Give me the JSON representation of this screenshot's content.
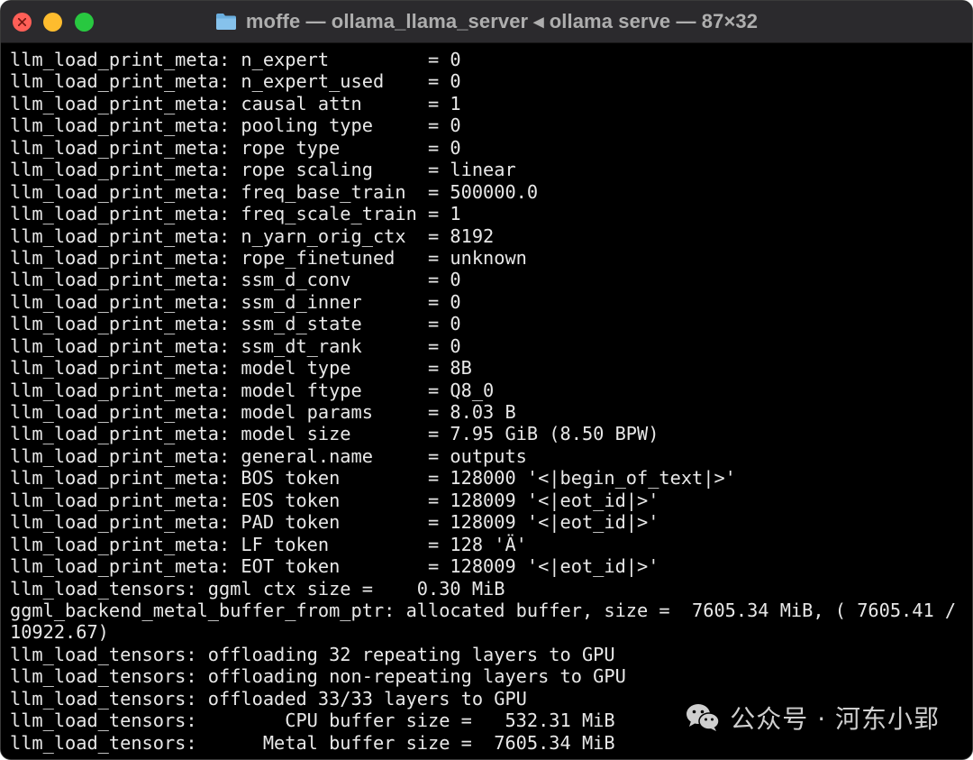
{
  "window": {
    "title": "moffe — ollama_llama_server ◂ ollama serve — 87×32",
    "folder_icon": "folder-icon",
    "colors": {
      "close": "#ff5f57",
      "minimize": "#febc2e",
      "zoom": "#28c840",
      "terminal_bg": "#000000",
      "terminal_fg": "#e8e8e8"
    }
  },
  "terminal": {
    "lines": [
      "llm_load_print_meta: n_expert         = 0",
      "llm_load_print_meta: n_expert_used    = 0",
      "llm_load_print_meta: causal attn      = 1",
      "llm_load_print_meta: pooling type     = 0",
      "llm_load_print_meta: rope type        = 0",
      "llm_load_print_meta: rope scaling     = linear",
      "llm_load_print_meta: freq_base_train  = 500000.0",
      "llm_load_print_meta: freq_scale_train = 1",
      "llm_load_print_meta: n_yarn_orig_ctx  = 8192",
      "llm_load_print_meta: rope_finetuned   = unknown",
      "llm_load_print_meta: ssm_d_conv       = 0",
      "llm_load_print_meta: ssm_d_inner      = 0",
      "llm_load_print_meta: ssm_d_state      = 0",
      "llm_load_print_meta: ssm_dt_rank      = 0",
      "llm_load_print_meta: model type       = 8B",
      "llm_load_print_meta: model ftype      = Q8_0",
      "llm_load_print_meta: model params     = 8.03 B",
      "llm_load_print_meta: model size       = 7.95 GiB (8.50 BPW)",
      "llm_load_print_meta: general.name     = outputs",
      "llm_load_print_meta: BOS token        = 128000 '<|begin_of_text|>'",
      "llm_load_print_meta: EOS token        = 128009 '<|eot_id|>'",
      "llm_load_print_meta: PAD token        = 128009 '<|eot_id|>'",
      "llm_load_print_meta: LF token         = 128 'Ä'",
      "llm_load_print_meta: EOT token        = 128009 '<|eot_id|>'",
      "llm_load_tensors: ggml ctx size =    0.30 MiB",
      "ggml_backend_metal_buffer_from_ptr: allocated buffer, size =  7605.34 MiB, ( 7605.41 /",
      "10922.67)",
      "llm_load_tensors: offloading 32 repeating layers to GPU",
      "llm_load_tensors: offloading non-repeating layers to GPU",
      "llm_load_tensors: offloaded 33/33 layers to GPU",
      "llm_load_tensors:        CPU buffer size =   532.31 MiB",
      "llm_load_tensors:      Metal buffer size =  7605.34 MiB"
    ]
  },
  "watermark": {
    "text": "公众号 · 河东小郢",
    "icon": "wechat-icon"
  }
}
